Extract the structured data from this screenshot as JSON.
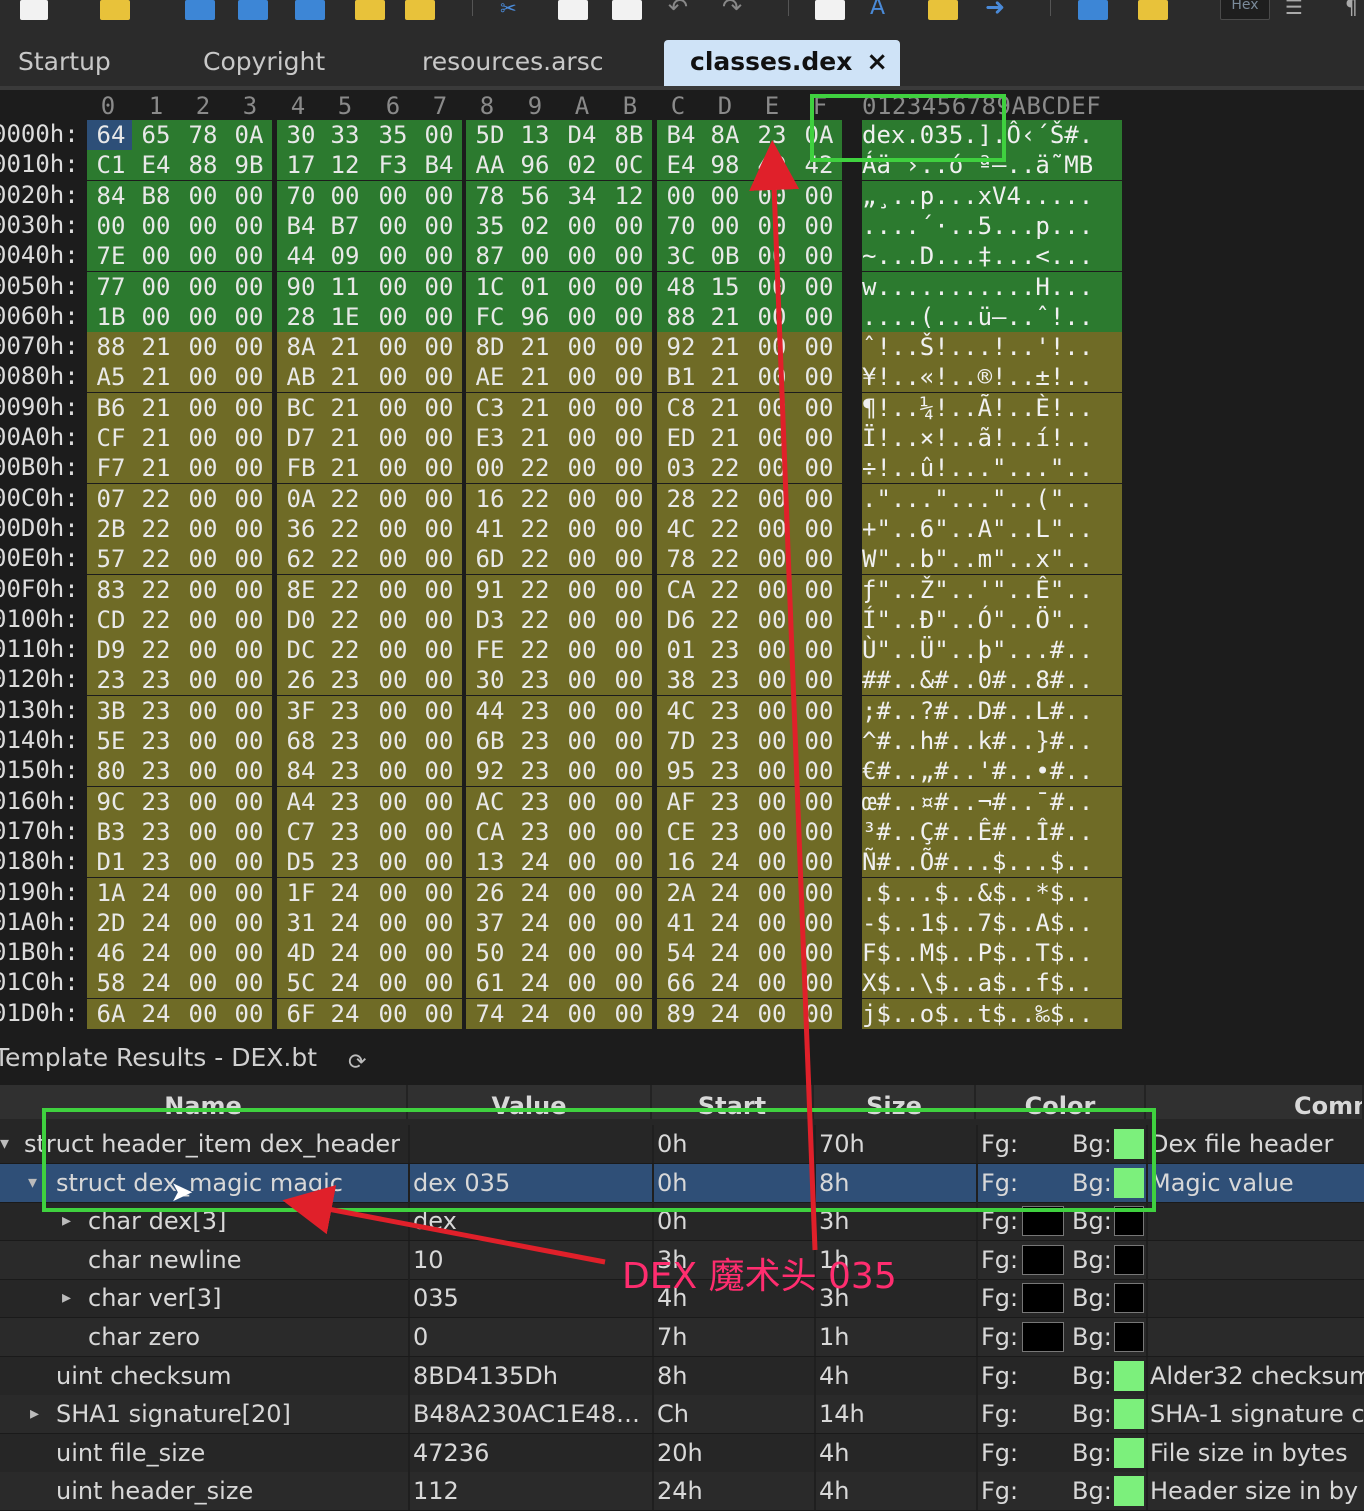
{
  "toolbar": {
    "hex_button_label": "Hex"
  },
  "tabs": [
    {
      "label": "Startup"
    },
    {
      "label": "Copyright"
    },
    {
      "label": "resources.arsc"
    },
    {
      "label": "classes.dex",
      "active": true,
      "close": "×"
    }
  ],
  "hex": {
    "column_headers": [
      "0",
      "1",
      "2",
      "3",
      "4",
      "5",
      "6",
      "7",
      "8",
      "9",
      "A",
      "B",
      "C",
      "D",
      "E",
      "F"
    ],
    "ascii_header": "0123456789ABCDEF",
    "rows": [
      {
        "addr": "0000h:",
        "bytes": [
          "64",
          "65",
          "78",
          "0A",
          "30",
          "33",
          "35",
          "00",
          "5D",
          "13",
          "D4",
          "8B",
          "B4",
          "8A",
          "23",
          "0A"
        ],
        "ascii": "dex.035.].Ô‹´Š#.",
        "color": "green"
      },
      {
        "addr": "0010h:",
        "bytes": [
          "C1",
          "E4",
          "88",
          "9B",
          "17",
          "12",
          "F3",
          "B4",
          "AA",
          "96",
          "02",
          "0C",
          "E4",
          "98",
          "4D",
          "42"
        ],
        "ascii": "Áä ›..ó ª–..ä˜MB",
        "color": "green"
      },
      {
        "addr": "0020h:",
        "bytes": [
          "84",
          "B8",
          "00",
          "00",
          "70",
          "00",
          "00",
          "00",
          "78",
          "56",
          "34",
          "12",
          "00",
          "00",
          "00",
          "00"
        ],
        "ascii": "„¸..p...xV4.....",
        "color": "green"
      },
      {
        "addr": "0030h:",
        "bytes": [
          "00",
          "00",
          "00",
          "00",
          "B4",
          "B7",
          "00",
          "00",
          "35",
          "02",
          "00",
          "00",
          "70",
          "00",
          "00",
          "00"
        ],
        "ascii": "....´·..5...p...",
        "color": "green"
      },
      {
        "addr": "0040h:",
        "bytes": [
          "7E",
          "00",
          "00",
          "00",
          "44",
          "09",
          "00",
          "00",
          "87",
          "00",
          "00",
          "00",
          "3C",
          "0B",
          "00",
          "00"
        ],
        "ascii": "~...D...‡...<...",
        "color": "green"
      },
      {
        "addr": "0050h:",
        "bytes": [
          "77",
          "00",
          "00",
          "00",
          "90",
          "11",
          "00",
          "00",
          "1C",
          "01",
          "00",
          "00",
          "48",
          "15",
          "00",
          "00"
        ],
        "ascii": "w...........H...",
        "color": "green"
      },
      {
        "addr": "0060h:",
        "bytes": [
          "1B",
          "00",
          "00",
          "00",
          "28",
          "1E",
          "00",
          "00",
          "FC",
          "96",
          "00",
          "00",
          "88",
          "21",
          "00",
          "00"
        ],
        "ascii": "....(...ü–..ˆ!..",
        "color": "green"
      },
      {
        "addr": "0070h:",
        "bytes": [
          "88",
          "21",
          "00",
          "00",
          "8A",
          "21",
          "00",
          "00",
          "8D",
          "21",
          "00",
          "00",
          "92",
          "21",
          "00",
          "00"
        ],
        "ascii": "ˆ!..Š!...!..'!..",
        "color": "olive"
      },
      {
        "addr": "0080h:",
        "bytes": [
          "A5",
          "21",
          "00",
          "00",
          "AB",
          "21",
          "00",
          "00",
          "AE",
          "21",
          "00",
          "00",
          "B1",
          "21",
          "00",
          "00"
        ],
        "ascii": "¥!..«!..®!..±!..",
        "color": "olive"
      },
      {
        "addr": "0090h:",
        "bytes": [
          "B6",
          "21",
          "00",
          "00",
          "BC",
          "21",
          "00",
          "00",
          "C3",
          "21",
          "00",
          "00",
          "C8",
          "21",
          "00",
          "00"
        ],
        "ascii": "¶!..¼!..Ã!..È!..",
        "color": "olive"
      },
      {
        "addr": "00A0h:",
        "bytes": [
          "CF",
          "21",
          "00",
          "00",
          "D7",
          "21",
          "00",
          "00",
          "E3",
          "21",
          "00",
          "00",
          "ED",
          "21",
          "00",
          "00"
        ],
        "ascii": "Ï!..×!..ã!..í!..",
        "color": "olive"
      },
      {
        "addr": "00B0h:",
        "bytes": [
          "F7",
          "21",
          "00",
          "00",
          "FB",
          "21",
          "00",
          "00",
          "00",
          "22",
          "00",
          "00",
          "03",
          "22",
          "00",
          "00"
        ],
        "ascii": "÷!..û!...\"...\"..",
        "color": "olive"
      },
      {
        "addr": "00C0h:",
        "bytes": [
          "07",
          "22",
          "00",
          "00",
          "0A",
          "22",
          "00",
          "00",
          "16",
          "22",
          "00",
          "00",
          "28",
          "22",
          "00",
          "00"
        ],
        "ascii": ".\"...\"...\"..(\"..",
        "color": "olive"
      },
      {
        "addr": "00D0h:",
        "bytes": [
          "2B",
          "22",
          "00",
          "00",
          "36",
          "22",
          "00",
          "00",
          "41",
          "22",
          "00",
          "00",
          "4C",
          "22",
          "00",
          "00"
        ],
        "ascii": "+\"..6\"..A\"..L\"..",
        "color": "olive"
      },
      {
        "addr": "00E0h:",
        "bytes": [
          "57",
          "22",
          "00",
          "00",
          "62",
          "22",
          "00",
          "00",
          "6D",
          "22",
          "00",
          "00",
          "78",
          "22",
          "00",
          "00"
        ],
        "ascii": "W\"..b\"..m\"..x\"..",
        "color": "olive"
      },
      {
        "addr": "00F0h:",
        "bytes": [
          "83",
          "22",
          "00",
          "00",
          "8E",
          "22",
          "00",
          "00",
          "91",
          "22",
          "00",
          "00",
          "CA",
          "22",
          "00",
          "00"
        ],
        "ascii": "ƒ\"..Ž\"..'\"..Ê\"..",
        "color": "olive"
      },
      {
        "addr": "0100h:",
        "bytes": [
          "CD",
          "22",
          "00",
          "00",
          "D0",
          "22",
          "00",
          "00",
          "D3",
          "22",
          "00",
          "00",
          "D6",
          "22",
          "00",
          "00"
        ],
        "ascii": "Í\"..Ð\"..Ó\"..Ö\"..",
        "color": "olive"
      },
      {
        "addr": "0110h:",
        "bytes": [
          "D9",
          "22",
          "00",
          "00",
          "DC",
          "22",
          "00",
          "00",
          "FE",
          "22",
          "00",
          "00",
          "01",
          "23",
          "00",
          "00"
        ],
        "ascii": "Ù\"..Ü\"..þ\"...#..",
        "color": "olive"
      },
      {
        "addr": "0120h:",
        "bytes": [
          "23",
          "23",
          "00",
          "00",
          "26",
          "23",
          "00",
          "00",
          "30",
          "23",
          "00",
          "00",
          "38",
          "23",
          "00",
          "00"
        ],
        "ascii": "##..&#..0#..8#..",
        "color": "olive"
      },
      {
        "addr": "0130h:",
        "bytes": [
          "3B",
          "23",
          "00",
          "00",
          "3F",
          "23",
          "00",
          "00",
          "44",
          "23",
          "00",
          "00",
          "4C",
          "23",
          "00",
          "00"
        ],
        "ascii": ";#..?#..D#..L#..",
        "color": "olive"
      },
      {
        "addr": "0140h:",
        "bytes": [
          "5E",
          "23",
          "00",
          "00",
          "68",
          "23",
          "00",
          "00",
          "6B",
          "23",
          "00",
          "00",
          "7D",
          "23",
          "00",
          "00"
        ],
        "ascii": "^#..h#..k#..}#..",
        "color": "olive"
      },
      {
        "addr": "0150h:",
        "bytes": [
          "80",
          "23",
          "00",
          "00",
          "84",
          "23",
          "00",
          "00",
          "92",
          "23",
          "00",
          "00",
          "95",
          "23",
          "00",
          "00"
        ],
        "ascii": "€#..„#..'#..•#..",
        "color": "olive"
      },
      {
        "addr": "0160h:",
        "bytes": [
          "9C",
          "23",
          "00",
          "00",
          "A4",
          "23",
          "00",
          "00",
          "AC",
          "23",
          "00",
          "00",
          "AF",
          "23",
          "00",
          "00"
        ],
        "ascii": "œ#..¤#..¬#..¯#..",
        "color": "olive"
      },
      {
        "addr": "0170h:",
        "bytes": [
          "B3",
          "23",
          "00",
          "00",
          "C7",
          "23",
          "00",
          "00",
          "CA",
          "23",
          "00",
          "00",
          "CE",
          "23",
          "00",
          "00"
        ],
        "ascii": "³#..Ç#..Ê#..Î#..",
        "color": "olive"
      },
      {
        "addr": "0180h:",
        "bytes": [
          "D1",
          "23",
          "00",
          "00",
          "D5",
          "23",
          "00",
          "00",
          "13",
          "24",
          "00",
          "00",
          "16",
          "24",
          "00",
          "00"
        ],
        "ascii": "Ñ#..Õ#...$...$..",
        "color": "olive"
      },
      {
        "addr": "0190h:",
        "bytes": [
          "1A",
          "24",
          "00",
          "00",
          "1F",
          "24",
          "00",
          "00",
          "26",
          "24",
          "00",
          "00",
          "2A",
          "24",
          "00",
          "00"
        ],
        "ascii": ".$...$..&$..*$..",
        "color": "olive"
      },
      {
        "addr": "01A0h:",
        "bytes": [
          "2D",
          "24",
          "00",
          "00",
          "31",
          "24",
          "00",
          "00",
          "37",
          "24",
          "00",
          "00",
          "41",
          "24",
          "00",
          "00"
        ],
        "ascii": "-$..1$..7$..A$..",
        "color": "olive"
      },
      {
        "addr": "01B0h:",
        "bytes": [
          "46",
          "24",
          "00",
          "00",
          "4D",
          "24",
          "00",
          "00",
          "50",
          "24",
          "00",
          "00",
          "54",
          "24",
          "00",
          "00"
        ],
        "ascii": "F$..M$..P$..T$..",
        "color": "olive"
      },
      {
        "addr": "01C0h:",
        "bytes": [
          "58",
          "24",
          "00",
          "00",
          "5C",
          "24",
          "00",
          "00",
          "61",
          "24",
          "00",
          "00",
          "66",
          "24",
          "00",
          "00"
        ],
        "ascii": "X$..\\$..a$..f$..",
        "color": "olive"
      },
      {
        "addr": "01D0h:",
        "bytes": [
          "6A",
          "24",
          "00",
          "00",
          "6F",
          "24",
          "00",
          "00",
          "74",
          "24",
          "00",
          "00",
          "89",
          "24",
          "00",
          "00"
        ],
        "ascii": "j$..o$..t$..‰$..",
        "color": "olive"
      }
    ]
  },
  "template": {
    "title": "Template Results - DEX.bt",
    "headers": [
      "Name",
      "Value",
      "Start",
      "Size",
      "Color",
      "Comment"
    ],
    "rows": [
      {
        "name": "struct header_item dex_header",
        "value": "",
        "start": "0h",
        "size": "70h",
        "fg": "Fg:",
        "bg": "Bg:",
        "comment": "Dex file header",
        "expander": "▾",
        "fg_swatch": "none",
        "bg_swatch": "green"
      },
      {
        "name": "struct dex_magic magic",
        "value": "dex 035",
        "start": "0h",
        "size": "8h",
        "fg": "Fg:",
        "bg": "Bg:",
        "comment": "Magic value",
        "expander": "▾",
        "fg_swatch": "none",
        "bg_swatch": "green"
      },
      {
        "name": "char dex[3]",
        "value": "dex",
        "start": "0h",
        "size": "3h",
        "fg": "Fg:",
        "bg": "Bg:",
        "comment": "",
        "expander": "▸",
        "fg_swatch": "black",
        "bg_swatch": "black"
      },
      {
        "name": "char newline",
        "value": "10",
        "start": "3h",
        "size": "1h",
        "fg": "Fg:",
        "bg": "Bg:",
        "comment": "",
        "expander": "",
        "fg_swatch": "black",
        "bg_swatch": "black"
      },
      {
        "name": "char ver[3]",
        "value": "035",
        "start": "4h",
        "size": "3h",
        "fg": "Fg:",
        "bg": "Bg:",
        "comment": "",
        "expander": "▸",
        "fg_swatch": "black",
        "bg_swatch": "black"
      },
      {
        "name": "char zero",
        "value": "0",
        "start": "7h",
        "size": "1h",
        "fg": "Fg:",
        "bg": "Bg:",
        "comment": "",
        "expander": "",
        "fg_swatch": "black",
        "bg_swatch": "black"
      },
      {
        "name": "uint checksum",
        "value": "8BD4135Dh",
        "start": "8h",
        "size": "4h",
        "fg": "Fg:",
        "bg": "Bg:",
        "comment": "Alder32 checksum",
        "expander": "",
        "fg_swatch": "none",
        "bg_swatch": "green"
      },
      {
        "name": "SHA1 signature[20]",
        "value": "B48A230AC1E48…",
        "start": "Ch",
        "size": "14h",
        "fg": "Fg:",
        "bg": "Bg:",
        "comment": "SHA-1 signature c",
        "expander": "▸",
        "fg_swatch": "none",
        "bg_swatch": "green"
      },
      {
        "name": "uint file_size",
        "value": "47236",
        "start": "20h",
        "size": "4h",
        "fg": "Fg:",
        "bg": "Bg:",
        "comment": "File size in bytes",
        "expander": "",
        "fg_swatch": "none",
        "bg_swatch": "green"
      },
      {
        "name": "uint header_size",
        "value": "112",
        "start": "24h",
        "size": "4h",
        "fg": "Fg:",
        "bg": "Bg:",
        "comment": "Header size in by",
        "expander": "",
        "fg_swatch": "none",
        "bg_swatch": "green"
      }
    ]
  },
  "annotation": {
    "label": "DEX 魔术头 035",
    "color": "#ff2d6f",
    "box_color": "#3fd13f"
  },
  "colors": {
    "header_region": "#2c7a2f",
    "data_region": "#6f6b26",
    "selection": "#2f4f77"
  }
}
